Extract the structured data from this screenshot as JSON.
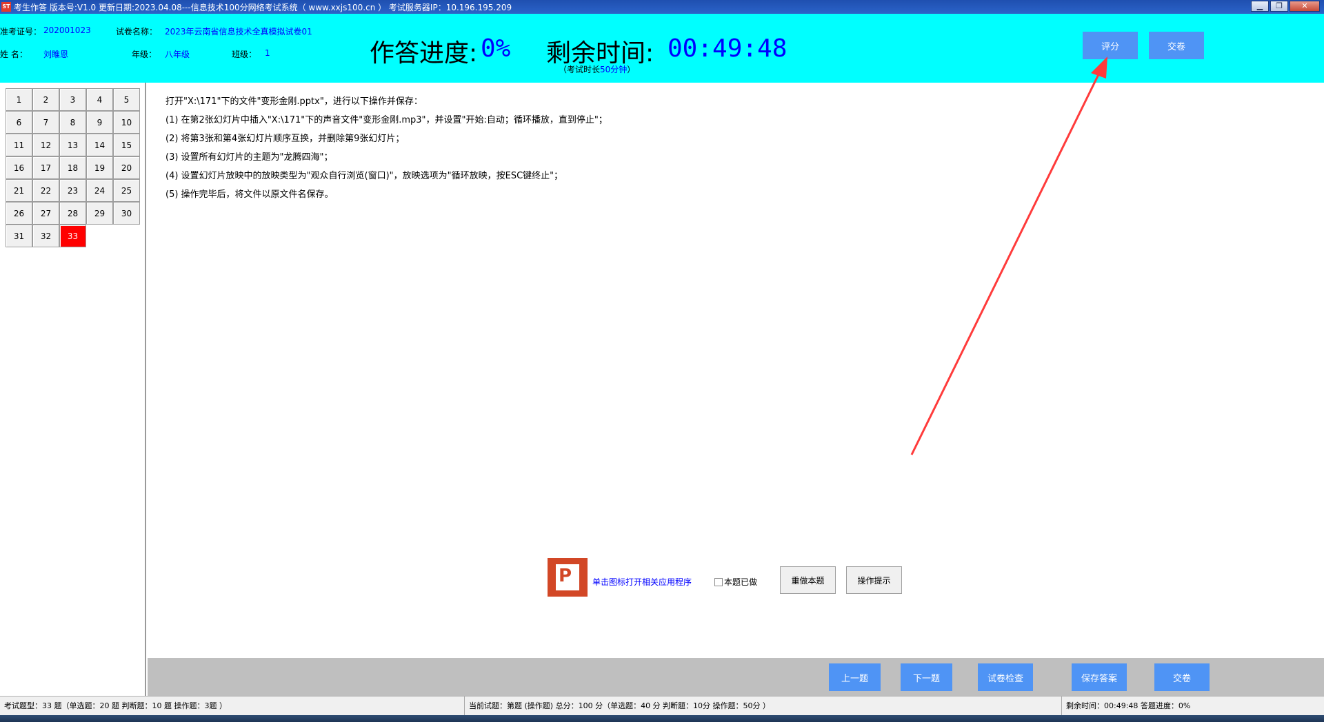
{
  "window": {
    "title": "考生作答 版本号:V1.0 更新日期:2023.04.08---信息技术100分网络考试系统（ www.xxjs100.cn ）    考试服务器IP：10.196.195.209",
    "min": "▁",
    "restore": "❐",
    "close": "✕"
  },
  "header": {
    "exam_id_label": "准考证号：",
    "exam_id": "202001023",
    "paper_label": "试卷名称：",
    "paper": "2023年云南省信息技术全真模拟试卷01",
    "name_label": "姓    名：",
    "name": "刘睢恩",
    "grade_label": "年级：",
    "grade": "八年级",
    "class_label": "班级：",
    "class": "1",
    "progress_label": "作答进度:",
    "progress": "0%",
    "remain_label": "剩余时间:",
    "remain": "00:49:48",
    "duration_prefix": "（考试时长",
    "duration": "50分钟",
    "duration_suffix": "）",
    "score_button": "评分",
    "submit_button": "交卷"
  },
  "question_grid": [
    "1",
    "2",
    "3",
    "4",
    "5",
    "6",
    "7",
    "8",
    "9",
    "10",
    "11",
    "12",
    "13",
    "14",
    "15",
    "16",
    "17",
    "18",
    "19",
    "20",
    "21",
    "22",
    "23",
    "24",
    "25",
    "26",
    "27",
    "28",
    "29",
    "30",
    "31",
    "32",
    "33"
  ],
  "current_question": "33",
  "question": {
    "lines": [
      "打开\"X:\\171\"下的文件\"变形金刚.pptx\"，进行以下操作并保存：",
      "(1) 在第2张幻灯片中插入\"X:\\171\"下的声音文件\"变形金刚.mp3\"，并设置\"开始:自动；循环播放，直到停止\"；",
      "(2) 将第3张和第4张幻灯片顺序互换，并删除第9张幻灯片；",
      "(3) 设置所有幻灯片的主题为\"龙腾四海\"；",
      "(4) 设置幻灯片放映中的放映类型为\"观众自行浏览(窗口)\"，放映选项为\"循环放映，按ESC键终止\"；",
      "(5) 操作完毕后，将文件以原文件名保存。"
    ],
    "open_app_link": "单击图标打开相关应用程序",
    "done_checkbox": "本题已做",
    "redo_button": "重做本题",
    "hint_button": "操作提示"
  },
  "bottom": {
    "prev": "上一题",
    "next": "下一题",
    "check": "试卷检查",
    "save": "保存答案",
    "submit": "交卷"
  },
  "status": {
    "types": "考试题型：33 题（单选题：20 题 判断题：10 题 操作题：3题 ）",
    "current": "当前试题：第题 (操作题) 总分：100 分（单选题：40 分 判断题：10分 操作题：50分 ）",
    "time": "剩余时间：00:49:48 答题进度：0%"
  },
  "colors": {
    "header_bg": "#00ffff",
    "button_blue": "#4f94f5",
    "current_cell": "#ff0000",
    "value_blue": "#0000ff",
    "arrow": "#ff3b3b"
  },
  "icons": {
    "ppt": "powerpoint-icon"
  }
}
